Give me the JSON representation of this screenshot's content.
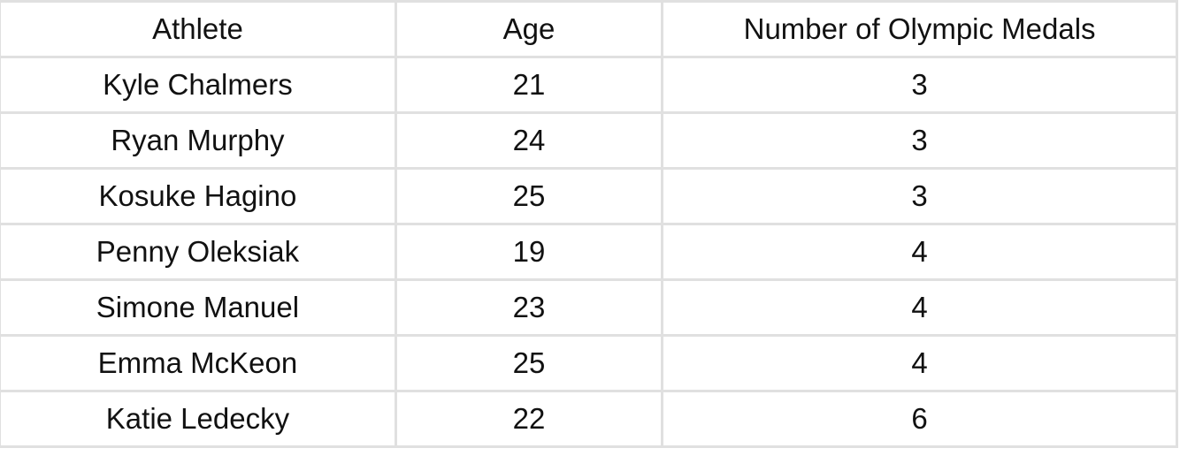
{
  "table": {
    "headers": [
      "Athlete",
      "Age",
      "Number of Olympic Medals"
    ],
    "rows": [
      [
        "Kyle Chalmers",
        "21",
        "3"
      ],
      [
        "Ryan Murphy",
        "24",
        "3"
      ],
      [
        "Kosuke Hagino",
        "25",
        "3"
      ],
      [
        "Penny Oleksiak",
        "19",
        "4"
      ],
      [
        "Simone Manuel",
        "23",
        "4"
      ],
      [
        "Emma McKeon",
        "25",
        "4"
      ],
      [
        "Katie Ledecky",
        "22",
        "6"
      ]
    ]
  }
}
